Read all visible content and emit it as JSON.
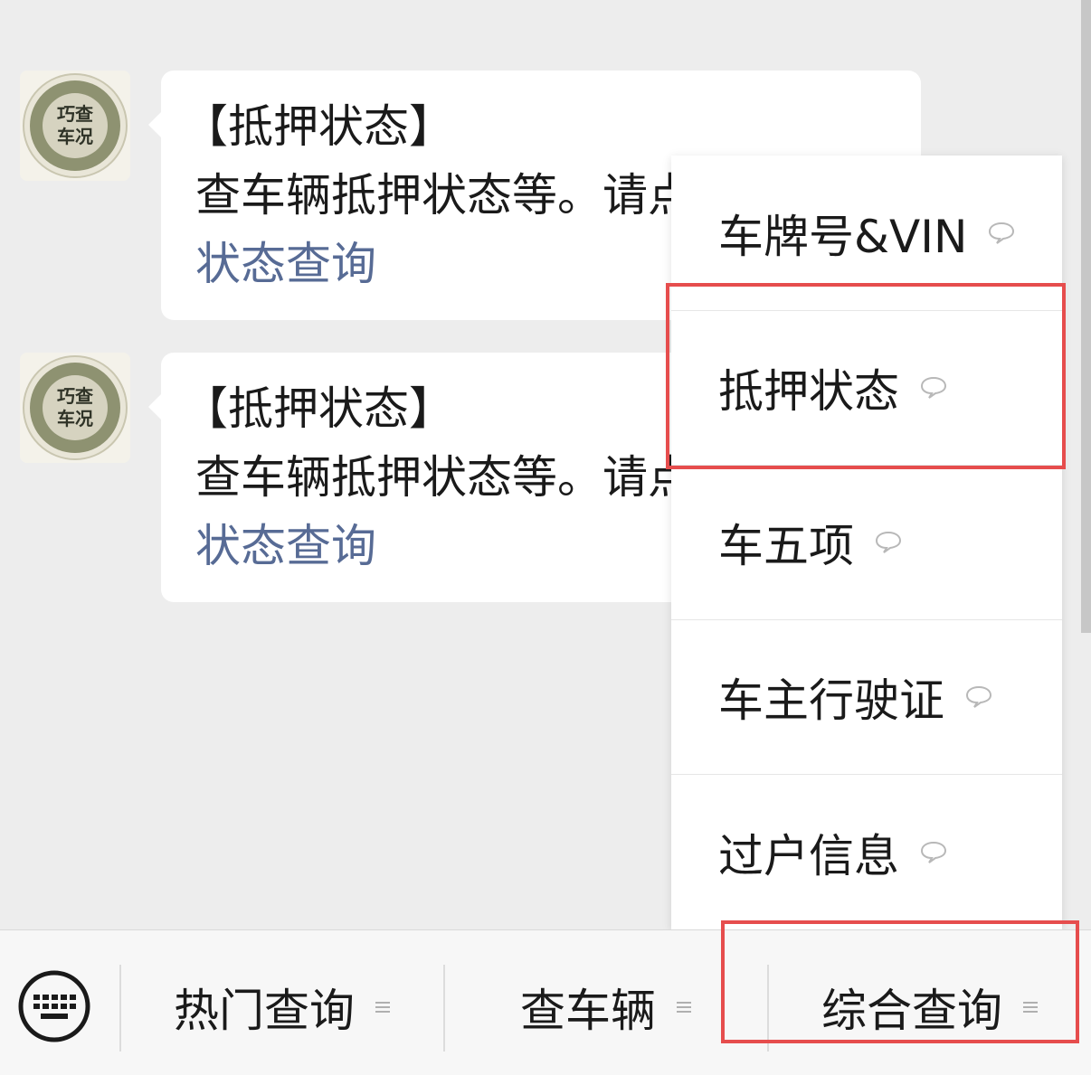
{
  "messages": [
    {
      "avatar_text": [
        "巧查",
        "车况"
      ],
      "title": "【抵押状态】",
      "description": "查车辆抵押状态等。请点",
      "link": "状态查询"
    },
    {
      "avatar_text": [
        "巧查",
        "车况"
      ],
      "title": "【抵押状态】",
      "description": "查车辆抵押状态等。请点",
      "link": "状态查询"
    }
  ],
  "popup_menu": {
    "items": [
      {
        "label": "车牌号&VIN",
        "icon": "chat-bubble-icon"
      },
      {
        "label": "抵押状态",
        "icon": "chat-bubble-icon"
      },
      {
        "label": "车五项",
        "icon": "chat-bubble-icon"
      },
      {
        "label": "车主行驶证",
        "icon": "chat-bubble-icon"
      },
      {
        "label": "过户信息",
        "icon": "chat-bubble-icon"
      }
    ]
  },
  "bottom_menu": {
    "keyboard_icon": "keyboard-icon",
    "items": [
      {
        "label": "热门查询",
        "icon": "menu-lines-icon"
      },
      {
        "label": "查车辆",
        "icon": "menu-lines-icon"
      },
      {
        "label": "综合查询",
        "icon": "menu-lines-icon"
      }
    ]
  },
  "colors": {
    "link": "#576b95",
    "highlight": "#e64d4d",
    "background": "#ededed"
  }
}
